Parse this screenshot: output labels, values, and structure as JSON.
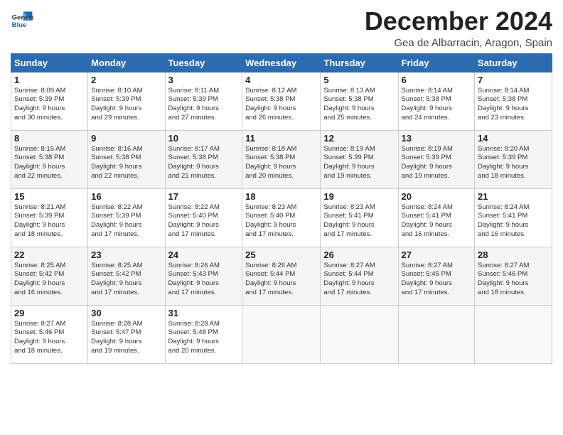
{
  "logo": {
    "line1": "General",
    "line2": "Blue"
  },
  "title": "December 2024",
  "subtitle": "Gea de Albarracin, Aragon, Spain",
  "days_header": [
    "Sunday",
    "Monday",
    "Tuesday",
    "Wednesday",
    "Thursday",
    "Friday",
    "Saturday"
  ],
  "weeks": [
    [
      {
        "day": "1",
        "content": "Sunrise: 8:09 AM\nSunset: 5:39 PM\nDaylight: 9 hours\nand 30 minutes."
      },
      {
        "day": "2",
        "content": "Sunrise: 8:10 AM\nSunset: 5:39 PM\nDaylight: 9 hours\nand 29 minutes."
      },
      {
        "day": "3",
        "content": "Sunrise: 8:11 AM\nSunset: 5:39 PM\nDaylight: 9 hours\nand 27 minutes."
      },
      {
        "day": "4",
        "content": "Sunrise: 8:12 AM\nSunset: 5:38 PM\nDaylight: 9 hours\nand 26 minutes."
      },
      {
        "day": "5",
        "content": "Sunrise: 8:13 AM\nSunset: 5:38 PM\nDaylight: 9 hours\nand 25 minutes."
      },
      {
        "day": "6",
        "content": "Sunrise: 8:14 AM\nSunset: 5:38 PM\nDaylight: 9 hours\nand 24 minutes."
      },
      {
        "day": "7",
        "content": "Sunrise: 8:14 AM\nSunset: 5:38 PM\nDaylight: 9 hours\nand 23 minutes."
      }
    ],
    [
      {
        "day": "8",
        "content": "Sunrise: 8:15 AM\nSunset: 5:38 PM\nDaylight: 9 hours\nand 22 minutes."
      },
      {
        "day": "9",
        "content": "Sunrise: 8:16 AM\nSunset: 5:38 PM\nDaylight: 9 hours\nand 22 minutes."
      },
      {
        "day": "10",
        "content": "Sunrise: 8:17 AM\nSunset: 5:38 PM\nDaylight: 9 hours\nand 21 minutes."
      },
      {
        "day": "11",
        "content": "Sunrise: 8:18 AM\nSunset: 5:38 PM\nDaylight: 9 hours\nand 20 minutes."
      },
      {
        "day": "12",
        "content": "Sunrise: 8:19 AM\nSunset: 5:39 PM\nDaylight: 9 hours\nand 19 minutes."
      },
      {
        "day": "13",
        "content": "Sunrise: 8:19 AM\nSunset: 5:39 PM\nDaylight: 9 hours\nand 19 minutes."
      },
      {
        "day": "14",
        "content": "Sunrise: 8:20 AM\nSunset: 5:39 PM\nDaylight: 9 hours\nand 18 minutes."
      }
    ],
    [
      {
        "day": "15",
        "content": "Sunrise: 8:21 AM\nSunset: 5:39 PM\nDaylight: 9 hours\nand 18 minutes."
      },
      {
        "day": "16",
        "content": "Sunrise: 8:22 AM\nSunset: 5:39 PM\nDaylight: 9 hours\nand 17 minutes."
      },
      {
        "day": "17",
        "content": "Sunrise: 8:22 AM\nSunset: 5:40 PM\nDaylight: 9 hours\nand 17 minutes."
      },
      {
        "day": "18",
        "content": "Sunrise: 8:23 AM\nSunset: 5:40 PM\nDaylight: 9 hours\nand 17 minutes."
      },
      {
        "day": "19",
        "content": "Sunrise: 8:23 AM\nSunset: 5:41 PM\nDaylight: 9 hours\nand 17 minutes."
      },
      {
        "day": "20",
        "content": "Sunrise: 8:24 AM\nSunset: 5:41 PM\nDaylight: 9 hours\nand 16 minutes."
      },
      {
        "day": "21",
        "content": "Sunrise: 8:24 AM\nSunset: 5:41 PM\nDaylight: 9 hours\nand 16 minutes."
      }
    ],
    [
      {
        "day": "22",
        "content": "Sunrise: 8:25 AM\nSunset: 5:42 PM\nDaylight: 9 hours\nand 16 minutes."
      },
      {
        "day": "23",
        "content": "Sunrise: 8:25 AM\nSunset: 5:42 PM\nDaylight: 9 hours\nand 17 minutes."
      },
      {
        "day": "24",
        "content": "Sunrise: 8:26 AM\nSunset: 5:43 PM\nDaylight: 9 hours\nand 17 minutes."
      },
      {
        "day": "25",
        "content": "Sunrise: 8:26 AM\nSunset: 5:44 PM\nDaylight: 9 hours\nand 17 minutes."
      },
      {
        "day": "26",
        "content": "Sunrise: 8:27 AM\nSunset: 5:44 PM\nDaylight: 9 hours\nand 17 minutes."
      },
      {
        "day": "27",
        "content": "Sunrise: 8:27 AM\nSunset: 5:45 PM\nDaylight: 9 hours\nand 17 minutes."
      },
      {
        "day": "28",
        "content": "Sunrise: 8:27 AM\nSunset: 5:46 PM\nDaylight: 9 hours\nand 18 minutes."
      }
    ],
    [
      {
        "day": "29",
        "content": "Sunrise: 8:27 AM\nSunset: 5:46 PM\nDaylight: 9 hours\nand 18 minutes."
      },
      {
        "day": "30",
        "content": "Sunrise: 8:28 AM\nSunset: 5:47 PM\nDaylight: 9 hours\nand 19 minutes."
      },
      {
        "day": "31",
        "content": "Sunrise: 8:28 AM\nSunset: 5:48 PM\nDaylight: 9 hours\nand 20 minutes."
      },
      {
        "day": "",
        "content": ""
      },
      {
        "day": "",
        "content": ""
      },
      {
        "day": "",
        "content": ""
      },
      {
        "day": "",
        "content": ""
      }
    ]
  ]
}
